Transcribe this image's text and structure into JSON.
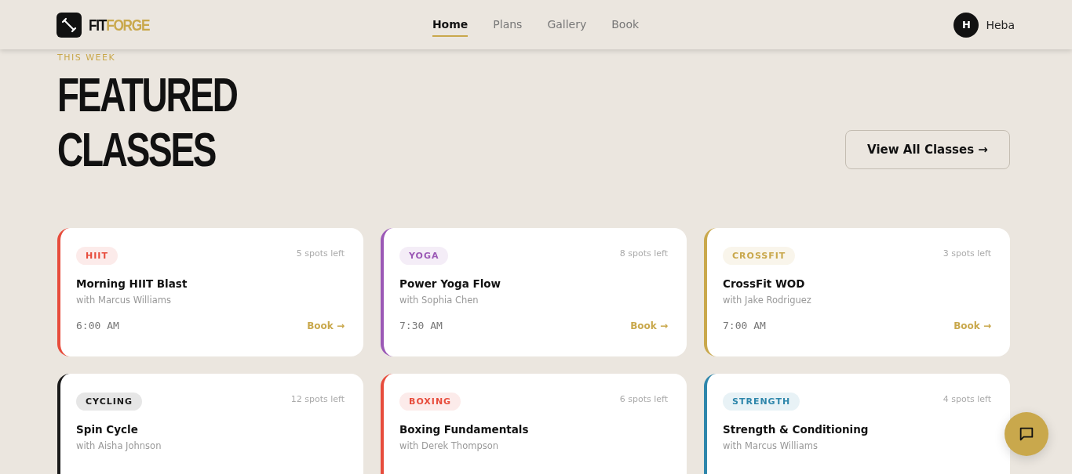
{
  "brand": {
    "first": "FIT",
    "second": "FORGE"
  },
  "nav": [
    {
      "label": "Home",
      "selected": true
    },
    {
      "label": "Plans",
      "selected": false
    },
    {
      "label": "Gallery",
      "selected": false
    },
    {
      "label": "Book",
      "selected": false
    }
  ],
  "user": {
    "initial": "H",
    "name": "Heba"
  },
  "section": {
    "eyebrow": "THIS WEEK",
    "title_lines": [
      "FEATURED",
      "CLASSES"
    ],
    "action": "View All Classes →"
  },
  "classes": [
    {
      "tag": "HIIT",
      "color": "#e74c3c",
      "spots": "5 spots left",
      "name": "Morning HIIT Blast",
      "trainer": "with Marcus Williams",
      "time": "6:00 AM",
      "book": "Book →"
    },
    {
      "tag": "YOGA",
      "color": "#9b59b6",
      "spots": "8 spots left",
      "name": "Power Yoga Flow",
      "trainer": "with Sophia Chen",
      "time": "7:30 AM",
      "book": "Book →"
    },
    {
      "tag": "CROSSFIT",
      "color": "#c9a84c",
      "spots": "3 spots left",
      "name": "CrossFit WOD",
      "trainer": "with Jake Rodriguez",
      "time": "7:00 AM",
      "book": "Book →"
    },
    {
      "tag": "CYCLING",
      "color": "#1a1a1a",
      "spots": "12 spots left",
      "name": "Spin Cycle",
      "trainer": "with Aisha Johnson"
    },
    {
      "tag": "BOXING",
      "color": "#e74c3c",
      "spots": "6 spots left",
      "name": "Boxing Fundamentals",
      "trainer": "with Derek Thompson"
    },
    {
      "tag": "STRENGTH",
      "color": "#2e86ab",
      "spots": "4 spots left",
      "name": "Strength & Conditioning",
      "trainer": "with Marcus Williams"
    }
  ]
}
